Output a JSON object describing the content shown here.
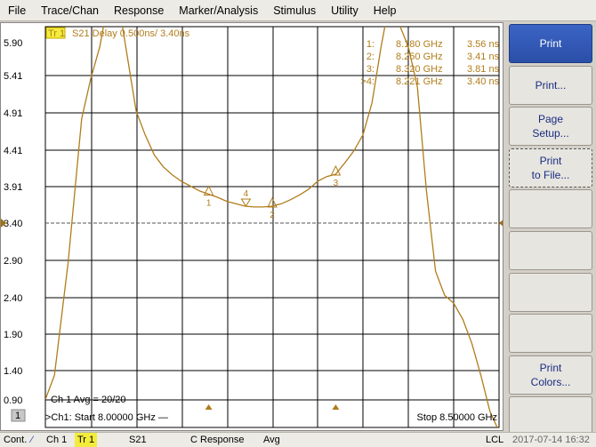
{
  "menu": [
    "File",
    "Trace/Chan",
    "Response",
    "Marker/Analysis",
    "Stimulus",
    "Utility",
    "Help"
  ],
  "trace": {
    "badge": "Tr 1",
    "title": "S21 Delay 0.500ns/  3.40ns",
    "channel_avg": "Ch 1 Avg =   20/20",
    "window_number": "1",
    "start": ">Ch1:  Start  8.00000 GHz —",
    "stop": "Stop  8.50000 GHz",
    "trace_color": "#b07d1a"
  },
  "markers": [
    {
      "label": "1:",
      "freq": "8.180 GHz",
      "value": "3.56 ns"
    },
    {
      "label": "2:",
      "freq": "8.250 GHz",
      "value": "3.41 ns"
    },
    {
      "label": "3:",
      "freq": "8.320 GHz",
      "value": "3.81 ns"
    },
    {
      "label": ">4:",
      "freq": "8.221 GHz",
      "value": "3.40 ns"
    }
  ],
  "softkeys": [
    {
      "lines": [
        "Print"
      ],
      "title": true
    },
    {
      "lines": [
        "Print..."
      ]
    },
    {
      "lines": [
        "Page",
        "Setup..."
      ]
    },
    {
      "lines": [
        "Print",
        "to File..."
      ],
      "focused": true
    },
    {
      "lines": []
    },
    {
      "lines": []
    },
    {
      "lines": []
    },
    {
      "lines": []
    },
    {
      "lines": [
        "Print",
        "Colors..."
      ]
    },
    {
      "lines": []
    }
  ],
  "status": {
    "mode": "Cont.",
    "channel": "Ch 1",
    "trace": "Tr 1",
    "param": "S21",
    "correction": "C  Response",
    "avg": "Avg",
    "ref": "LCL",
    "datetime": "2017-07-14 16:32"
  },
  "chart_data": {
    "type": "line",
    "title": "S21 Delay 0.500ns/  3.40ns",
    "xlabel": "",
    "ylabel": "",
    "xlim": [
      8.0,
      8.5
    ],
    "ylim": [
      0.65,
      5.65
    ],
    "yticks": [
      "5.90",
      "5.41",
      "4.91",
      "4.41",
      "3.91",
      "3.40",
      "2.90",
      "2.40",
      "1.90",
      "1.40",
      "0.90"
    ],
    "grid": true,
    "series": [
      {
        "x": [
          8.0,
          8.01,
          8.025,
          8.04,
          8.05,
          8.06,
          8.068,
          8.08,
          8.09,
          8.1,
          8.11,
          8.12,
          8.13,
          8.14,
          8.15,
          8.16,
          8.17,
          8.18,
          8.19,
          8.2,
          8.21,
          8.22,
          8.23,
          8.24,
          8.25,
          8.26,
          8.27,
          8.28,
          8.29,
          8.3,
          8.31,
          8.32,
          8.33,
          8.34,
          8.35,
          8.36,
          8.37,
          8.375,
          8.385,
          8.39,
          8.4,
          8.41,
          8.42,
          8.43,
          8.44,
          8.45,
          8.46,
          8.47,
          8.48,
          8.49,
          8.5
        ],
        "y": [
          1.0,
          1.3,
          2.7,
          4.5,
          5.0,
          5.4,
          5.9,
          6.0,
          5.3,
          4.6,
          4.3,
          4.05,
          3.9,
          3.8,
          3.72,
          3.66,
          3.6,
          3.56,
          3.52,
          3.47,
          3.44,
          3.41,
          3.4,
          3.4,
          3.41,
          3.44,
          3.49,
          3.55,
          3.62,
          3.72,
          3.78,
          3.81,
          3.95,
          4.1,
          4.3,
          4.7,
          5.4,
          5.7,
          5.75,
          5.68,
          5.4,
          4.9,
          3.6,
          2.6,
          2.3,
          2.2,
          2.0,
          1.7,
          1.3,
          0.85,
          0.6
        ]
      }
    ]
  }
}
